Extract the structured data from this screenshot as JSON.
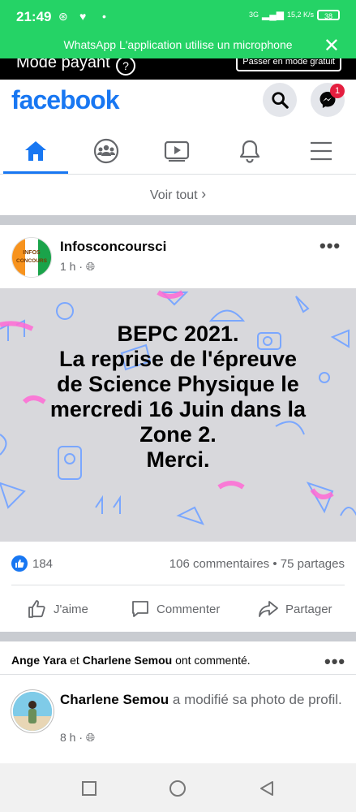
{
  "status_bar": {
    "time": "21:49",
    "network": "3G",
    "speed": "15,2 K/s",
    "battery": "38"
  },
  "banner": {
    "text": "WhatsApp L'application utilise un microphone"
  },
  "mode_bar": {
    "label": "Mode payant",
    "button": "Passer en mode gratuit"
  },
  "header": {
    "logo": "facebook",
    "messenger_badge": "1"
  },
  "see_all": "Voir tout",
  "post": {
    "author": "Infosconcoursci",
    "time": "1 h",
    "avatar_text": "INFOS CONCOURS",
    "lines": [
      "BEPC 2021.",
      "La reprise de l'épreuve",
      "de Science Physique le",
      "mercredi 16 Juin dans la",
      "Zone 2.",
      "Merci."
    ],
    "reactions_count": "184",
    "comments": "106 commentaires",
    "shares": "75 partages",
    "actions": {
      "like": "J'aime",
      "comment": "Commenter",
      "share": "Partager"
    }
  },
  "activity": {
    "name1": "Ange Yara",
    "connector": "et",
    "name2": "Charlene Semou",
    "suffix": "ont commenté."
  },
  "story2": {
    "name": "Charlene Semou",
    "action": "a modifié sa photo de profil.",
    "time": "8 h"
  },
  "colors": {
    "facebook_blue": "#1877f2",
    "whatsapp_green": "#25d366",
    "badge_red": "#e41e3f"
  }
}
